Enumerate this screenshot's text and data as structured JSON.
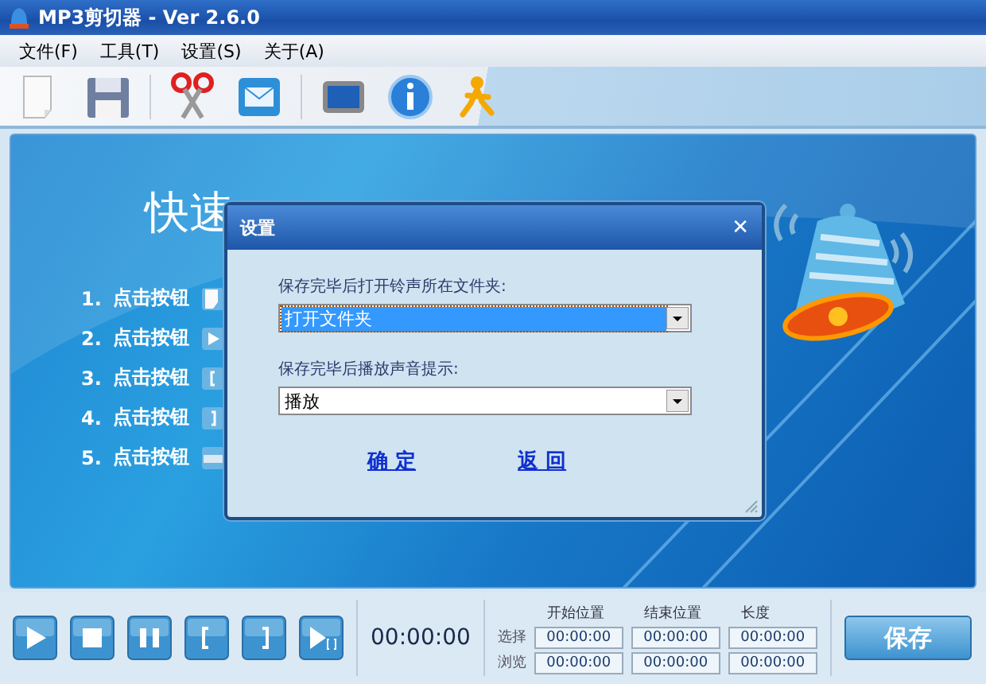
{
  "window": {
    "title": "MP3剪切器 - Ver 2.6.0"
  },
  "menu": [
    "文件(F)",
    "工具(T)",
    "设置(S)",
    "关于(A)"
  ],
  "toolbar": [
    {
      "kind": "new"
    },
    {
      "kind": "save"
    },
    {
      "kind": "sep"
    },
    {
      "kind": "cut"
    },
    {
      "kind": "mail"
    },
    {
      "kind": "sep"
    },
    {
      "kind": "screen"
    },
    {
      "kind": "info"
    },
    {
      "kind": "person"
    }
  ],
  "guide": {
    "heading": "快速",
    "steps": [
      {
        "number": "1.",
        "label": "点击按钮",
        "kind": "new"
      },
      {
        "number": "2.",
        "label": "点击按钮",
        "kind": "play"
      },
      {
        "number": "3.",
        "label": "点击按钮",
        "kind": "mark_start"
      },
      {
        "number": "4.",
        "label": "点击按钮",
        "kind": "mark_end"
      },
      {
        "number": "5.",
        "label": "点击按钮",
        "kind": "save"
      }
    ]
  },
  "dialog": {
    "title": "设置",
    "close": "✕",
    "fields": [
      {
        "label": "保存完毕后打开铃声所在文件夹:",
        "value": "打开文件夹",
        "selected": true
      },
      {
        "label": "保存完毕后播放声音提示:",
        "value": "播放",
        "selected": false
      }
    ],
    "buttons": [
      "确 定",
      "返 回"
    ]
  },
  "transport": [
    {
      "kind": "play"
    },
    {
      "kind": "stop"
    },
    {
      "kind": "pause"
    },
    {
      "kind": "mark_start"
    },
    {
      "kind": "mark_end"
    },
    {
      "kind": "play_selection"
    }
  ],
  "time": "00:00:00",
  "positions": {
    "columns": [
      "开始位置",
      "结束位置",
      "长度"
    ],
    "rows": [
      {
        "label": "选择",
        "values": [
          "00:00:00",
          "00:00:00",
          "00:00:00"
        ]
      },
      {
        "label": "浏览",
        "values": [
          "00:00:00",
          "00:00:00",
          "00:00:00"
        ]
      }
    ]
  },
  "save_button": "保存"
}
